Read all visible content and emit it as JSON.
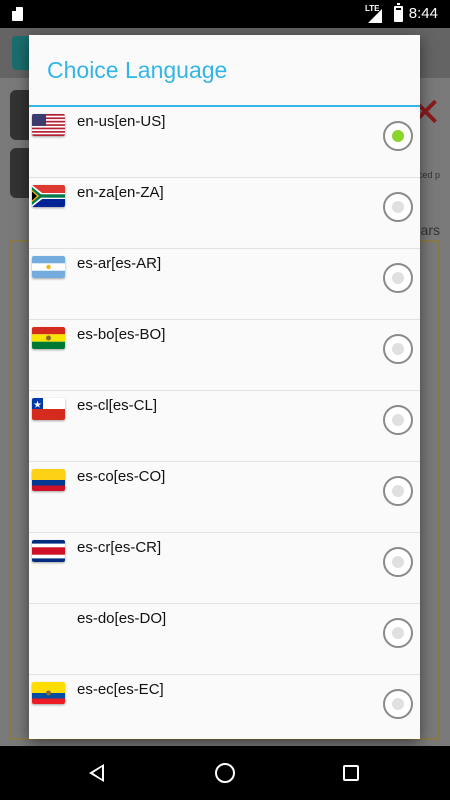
{
  "status_bar": {
    "network": "LTE",
    "time": "8:44"
  },
  "background": {
    "side_text": "ars",
    "side_text_small": "ced p"
  },
  "dialog": {
    "title": "Choice Language",
    "selected": "en-us[en-US]",
    "items": [
      {
        "label": "en-us[en-US]",
        "flag": "us-flag-icon",
        "checked": true
      },
      {
        "label": "en-za[en-ZA]",
        "flag": "za-flag-icon",
        "checked": false
      },
      {
        "label": "es-ar[es-AR]",
        "flag": "ar-flag-icon",
        "checked": false
      },
      {
        "label": "es-bo[es-BO]",
        "flag": "bo-flag-icon",
        "checked": false
      },
      {
        "label": "es-cl[es-CL]",
        "flag": "cl-flag-icon",
        "checked": false
      },
      {
        "label": "es-co[es-CO]",
        "flag": "co-flag-icon",
        "checked": false
      },
      {
        "label": "es-cr[es-CR]",
        "flag": "cr-flag-icon",
        "checked": false
      },
      {
        "label": "es-do[es-DO]",
        "flag": "",
        "checked": false
      },
      {
        "label": "es-ec[es-EC]",
        "flag": "ec-flag-icon",
        "checked": false
      }
    ]
  },
  "colors": {
    "accent": "#33b5e5",
    "radio_checked": "#8bd42a"
  },
  "nav": {
    "back": "back-icon",
    "home": "home-icon",
    "recents": "recents-icon"
  }
}
